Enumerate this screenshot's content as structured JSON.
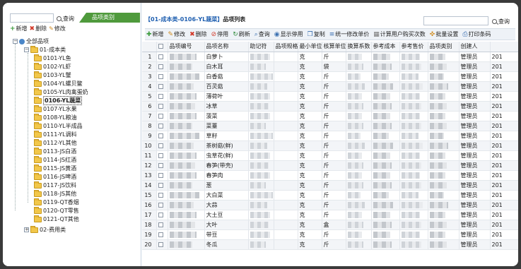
{
  "left": {
    "search_label": "查询",
    "category_tab": "品项类别",
    "tools": {
      "add": "新增",
      "delete": "删除",
      "edit": "修改"
    },
    "tree": {
      "root": "全部品项",
      "group1": "01-成本类",
      "items": [
        "0101-YL鱼",
        "0102-YL虾",
        "0103-YL蟹",
        "0104-YL螺贝鳖",
        "0105-YL肉禽蛋奶",
        "0106-YL蔬菜",
        "0107-YL水果",
        "0108-YL粮油",
        "0110-YL半成品",
        "0111-YL调料",
        "0112-YL其他",
        "0113-JS白酒",
        "0114-JS红酒",
        "0115-JS黄酒",
        "0116-JS啤酒",
        "0117-JS饮料",
        "0118-JS其他",
        "0119-QT香烟",
        "0120-QT零售",
        "0121-QT其他"
      ],
      "selected_index": 5,
      "group2": "02-费用类"
    }
  },
  "right": {
    "title_path": "【01-成本类-0106-YL蔬菜】",
    "title_suffix": "品项列表",
    "search_label": "查询",
    "toolbar": [
      {
        "label": "新增",
        "icon": "plus-icon",
        "color": "#3a9a3a"
      },
      {
        "label": "修改",
        "icon": "pencil-icon",
        "color": "#d08a1c"
      },
      {
        "label": "删除",
        "icon": "x-icon",
        "color": "#d33a2a"
      },
      {
        "label": "停用",
        "icon": "stop-icon",
        "color": "#d33a2a"
      },
      {
        "label": "刷新",
        "icon": "refresh-icon",
        "color": "#2d8a3a"
      },
      {
        "label": "查询",
        "icon": "search-icon",
        "color": "#3a6fb0"
      },
      {
        "label": "显示停用",
        "icon": "eye-icon",
        "color": "#3a6fb0"
      },
      {
        "label": "复制",
        "icon": "copy-icon",
        "color": "#3a6fb0"
      },
      {
        "label": "统一修改单价",
        "icon": "list-icon",
        "color": "#3a6fb0"
      },
      {
        "label": "计算用户购买次数",
        "icon": "calc-icon",
        "color": "#777777"
      },
      {
        "label": "批量设置",
        "icon": "wrench-icon",
        "color": "#d08a1c"
      },
      {
        "label": "打印条码",
        "icon": "print-icon",
        "color": "#3a6fb0"
      }
    ],
    "columns": [
      "品项编号",
      "品项名称",
      "助记符",
      "品项规格",
      "最小单位",
      "核算单位",
      "换算系数",
      "参考成本",
      "参考售价",
      "品项类别",
      "创建人"
    ],
    "rows": [
      {
        "n": "1",
        "name": "白萝卜",
        "min": "克",
        "acc": "斤",
        "creator": "管理员",
        "date": "201"
      },
      {
        "n": "2",
        "name": "白木耳",
        "min": "克",
        "acc": "袋",
        "creator": "管理员",
        "date": "201"
      },
      {
        "n": "3",
        "name": "白香菇",
        "min": "克",
        "acc": "斤",
        "creator": "管理员",
        "date": "201"
      },
      {
        "n": "4",
        "name": "百灵菇",
        "min": "克",
        "acc": "斤",
        "creator": "管理员",
        "date": "201"
      },
      {
        "n": "5",
        "name": "薄荷叶",
        "min": "克",
        "acc": "斤",
        "creator": "管理员",
        "date": "201"
      },
      {
        "n": "6",
        "name": "冰草",
        "min": "克",
        "acc": "斤",
        "creator": "管理员",
        "date": "201"
      },
      {
        "n": "7",
        "name": "菠菜",
        "min": "克",
        "acc": "斤",
        "creator": "管理员",
        "date": "201"
      },
      {
        "n": "8",
        "name": "菜薹",
        "min": "克",
        "acc": "斤",
        "creator": "管理员",
        "date": "201"
      },
      {
        "n": "9",
        "name": "草籽",
        "min": "克",
        "acc": "斤",
        "creator": "管理员",
        "date": "201"
      },
      {
        "n": "10",
        "name": "茶树菇(鲜)",
        "min": "克",
        "acc": "斤",
        "creator": "管理员",
        "date": "201"
      },
      {
        "n": "11",
        "name": "虫草花(鲜)",
        "min": "克",
        "acc": "斤",
        "creator": "管理员",
        "date": "201"
      },
      {
        "n": "12",
        "name": "春笋(带壳)",
        "min": "克",
        "acc": "斤",
        "creator": "管理员",
        "date": "201"
      },
      {
        "n": "13",
        "name": "春笋肉",
        "min": "克",
        "acc": "斤",
        "creator": "管理员",
        "date": "201"
      },
      {
        "n": "14",
        "name": "葱",
        "min": "克",
        "acc": "斤",
        "creator": "管理员",
        "date": "201"
      },
      {
        "n": "15",
        "name": "大白菜",
        "min": "克",
        "acc": "斤",
        "creator": "管理员",
        "date": "201"
      },
      {
        "n": "16",
        "name": "大蒜",
        "min": "克",
        "acc": "斤",
        "creator": "管理员",
        "date": "201"
      },
      {
        "n": "17",
        "name": "大土豆",
        "min": "克",
        "acc": "斤",
        "creator": "管理员",
        "date": "201"
      },
      {
        "n": "18",
        "name": "大叶",
        "min": "克",
        "acc": "盒",
        "creator": "管理员",
        "date": "201"
      },
      {
        "n": "19",
        "name": "带豆",
        "min": "克",
        "acc": "斤",
        "creator": "管理员",
        "date": "201"
      },
      {
        "n": "20",
        "name": "冬瓜",
        "min": "克",
        "acc": "斤",
        "creator": "管理员",
        "date": "201"
      }
    ]
  }
}
